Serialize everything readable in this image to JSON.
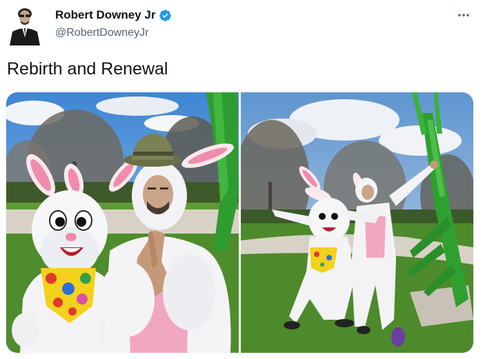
{
  "author": {
    "display_name": "Robert Downey Jr",
    "handle": "@RobertDowneyJr",
    "verified": true,
    "verified_color": "#1d9bf0",
    "avatar_icon": "avatar-person-in-suit"
  },
  "tweet": {
    "text": "Rebirth and Renewal"
  },
  "menu": {
    "icon": "more-horizontal-icon"
  },
  "media": {
    "count": 2,
    "photos": [
      {
        "description_icon": "photo-easter-bunnies-1"
      },
      {
        "description_icon": "photo-easter-bunnies-2"
      }
    ]
  }
}
